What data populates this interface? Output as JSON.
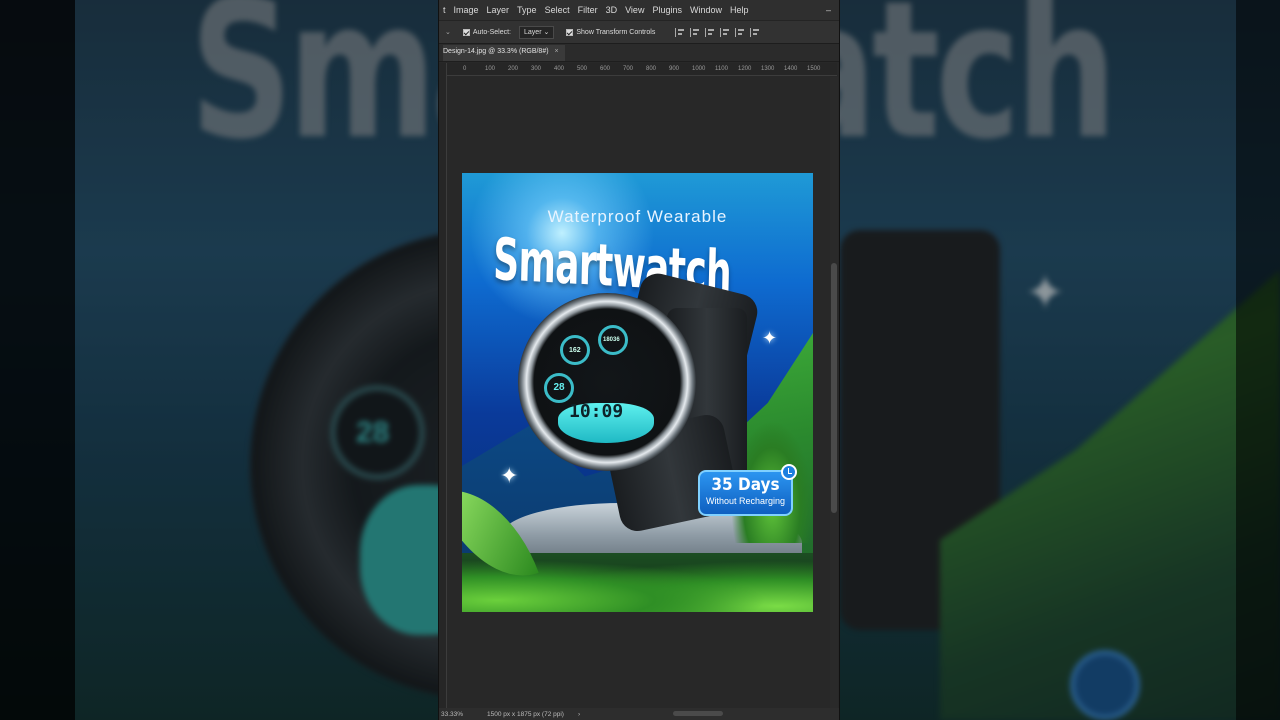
{
  "background": {
    "blurred_title": "Smartwatch",
    "blurred_dial_number": "28"
  },
  "menubar": {
    "items": [
      "t",
      "Image",
      "Layer",
      "Type",
      "Select",
      "Filter",
      "3D",
      "View",
      "Plugins",
      "Window",
      "Help"
    ],
    "minimize": "–"
  },
  "options": {
    "auto_select_label": "Auto-Select:",
    "auto_select_value": "Layer",
    "transform_label": "Show Transform Controls"
  },
  "document_tab": {
    "title": "Design-14.jpg @ 33.3% (RGB/8#)",
    "close": "×"
  },
  "ruler": {
    "ticks": [
      "0",
      "100",
      "200",
      "300",
      "400",
      "500",
      "600",
      "700",
      "800",
      "900",
      "1000",
      "1100",
      "1200",
      "1300",
      "1400",
      "1500"
    ]
  },
  "poster": {
    "subtitle": "Waterproof Wearable",
    "title": "Smartwatch",
    "watch_time": "10:09",
    "dial_left": "28",
    "dial_top_left": "162",
    "dial_top_right": "18036",
    "badge_days": "35 Days",
    "badge_sub": "Without Recharging",
    "star_glyph": "✦"
  },
  "status": {
    "zoom": "33.33%",
    "dimensions": "1500 px x 1875 px (72 ppi)",
    "arrow": "›"
  },
  "colors": {
    "app_bg": "#282828",
    "poster_blue": "#0e6bd0",
    "badge_blue": "#1d7fe0",
    "dial_cyan": "#3bbcc8"
  }
}
